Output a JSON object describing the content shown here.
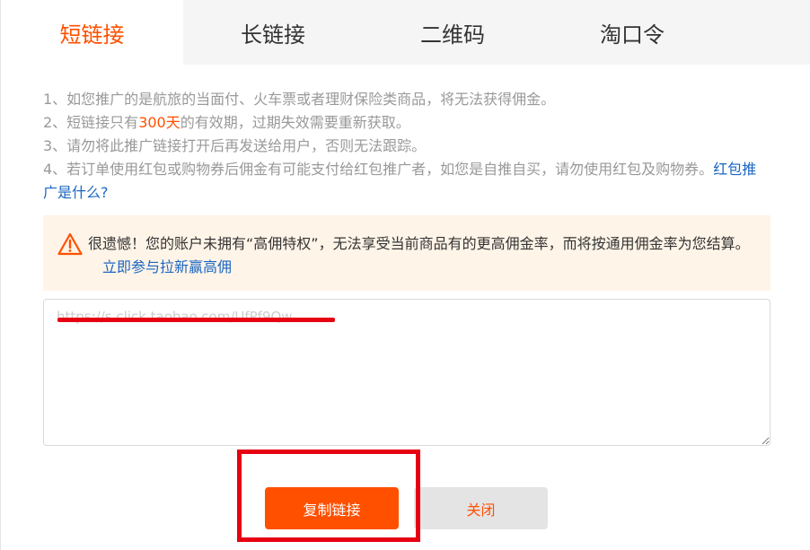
{
  "tabs": [
    {
      "label": "短链接",
      "active": true
    },
    {
      "label": "长链接",
      "active": false
    },
    {
      "label": "二维码",
      "active": false
    },
    {
      "label": "淘口令",
      "active": false
    }
  ],
  "notes": {
    "line1": "1、如您推广的是航旅的当面付、火车票或者理财保险类商品，将无法获得佣金。",
    "line2_prefix": "2、短链接只有",
    "line2_highlight": "300天",
    "line2_suffix": "的有效期，过期失效需要重新获取。",
    "line3": "3、请勿将此推广链接打开后再发送给用户，否则无法跟踪。",
    "line4": "4、若订单使用红包或购物券后佣金有可能支付给红包推广者，如您是自推自买，请勿使用红包及购物券。",
    "line4_link": "红包推广是什么?"
  },
  "warning": {
    "text": "很遗憾！您的账户未拥有“高佣特权”，无法享受当前商品有的更高佣金率，而将按通用佣金率为您结算。",
    "link": "立即参与拉新赢高佣"
  },
  "link_box": {
    "value": "https://s.click.taobao.com/UfPf9Qw"
  },
  "buttons": {
    "copy": "复制链接",
    "close": "关闭"
  },
  "colors": {
    "accent": "#ff5000",
    "link": "#1a66c2",
    "warning_bg": "#fff4e8",
    "annotation": "#e60012"
  }
}
